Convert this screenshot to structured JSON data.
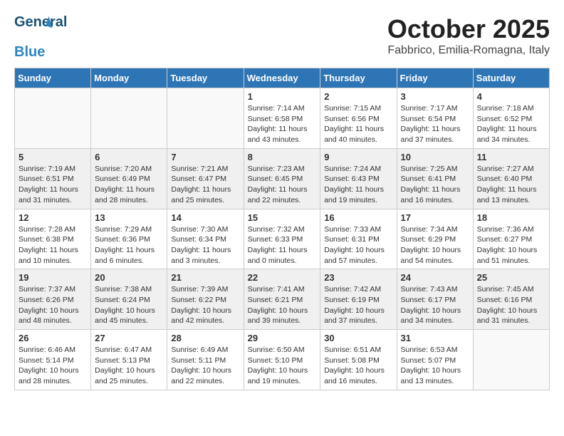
{
  "header": {
    "logo_line1": "General",
    "logo_line2": "Blue",
    "month": "October 2025",
    "location": "Fabbrico, Emilia-Romagna, Italy"
  },
  "weekdays": [
    "Sunday",
    "Monday",
    "Tuesday",
    "Wednesday",
    "Thursday",
    "Friday",
    "Saturday"
  ],
  "weeks": [
    [
      {
        "day": "",
        "info": ""
      },
      {
        "day": "",
        "info": ""
      },
      {
        "day": "",
        "info": ""
      },
      {
        "day": "1",
        "info": "Sunrise: 7:14 AM\nSunset: 6:58 PM\nDaylight: 11 hours\nand 43 minutes."
      },
      {
        "day": "2",
        "info": "Sunrise: 7:15 AM\nSunset: 6:56 PM\nDaylight: 11 hours\nand 40 minutes."
      },
      {
        "day": "3",
        "info": "Sunrise: 7:17 AM\nSunset: 6:54 PM\nDaylight: 11 hours\nand 37 minutes."
      },
      {
        "day": "4",
        "info": "Sunrise: 7:18 AM\nSunset: 6:52 PM\nDaylight: 11 hours\nand 34 minutes."
      }
    ],
    [
      {
        "day": "5",
        "info": "Sunrise: 7:19 AM\nSunset: 6:51 PM\nDaylight: 11 hours\nand 31 minutes."
      },
      {
        "day": "6",
        "info": "Sunrise: 7:20 AM\nSunset: 6:49 PM\nDaylight: 11 hours\nand 28 minutes."
      },
      {
        "day": "7",
        "info": "Sunrise: 7:21 AM\nSunset: 6:47 PM\nDaylight: 11 hours\nand 25 minutes."
      },
      {
        "day": "8",
        "info": "Sunrise: 7:23 AM\nSunset: 6:45 PM\nDaylight: 11 hours\nand 22 minutes."
      },
      {
        "day": "9",
        "info": "Sunrise: 7:24 AM\nSunset: 6:43 PM\nDaylight: 11 hours\nand 19 minutes."
      },
      {
        "day": "10",
        "info": "Sunrise: 7:25 AM\nSunset: 6:41 PM\nDaylight: 11 hours\nand 16 minutes."
      },
      {
        "day": "11",
        "info": "Sunrise: 7:27 AM\nSunset: 6:40 PM\nDaylight: 11 hours\nand 13 minutes."
      }
    ],
    [
      {
        "day": "12",
        "info": "Sunrise: 7:28 AM\nSunset: 6:38 PM\nDaylight: 11 hours\nand 10 minutes."
      },
      {
        "day": "13",
        "info": "Sunrise: 7:29 AM\nSunset: 6:36 PM\nDaylight: 11 hours\nand 6 minutes."
      },
      {
        "day": "14",
        "info": "Sunrise: 7:30 AM\nSunset: 6:34 PM\nDaylight: 11 hours\nand 3 minutes."
      },
      {
        "day": "15",
        "info": "Sunrise: 7:32 AM\nSunset: 6:33 PM\nDaylight: 11 hours\nand 0 minutes."
      },
      {
        "day": "16",
        "info": "Sunrise: 7:33 AM\nSunset: 6:31 PM\nDaylight: 10 hours\nand 57 minutes."
      },
      {
        "day": "17",
        "info": "Sunrise: 7:34 AM\nSunset: 6:29 PM\nDaylight: 10 hours\nand 54 minutes."
      },
      {
        "day": "18",
        "info": "Sunrise: 7:36 AM\nSunset: 6:27 PM\nDaylight: 10 hours\nand 51 minutes."
      }
    ],
    [
      {
        "day": "19",
        "info": "Sunrise: 7:37 AM\nSunset: 6:26 PM\nDaylight: 10 hours\nand 48 minutes."
      },
      {
        "day": "20",
        "info": "Sunrise: 7:38 AM\nSunset: 6:24 PM\nDaylight: 10 hours\nand 45 minutes."
      },
      {
        "day": "21",
        "info": "Sunrise: 7:39 AM\nSunset: 6:22 PM\nDaylight: 10 hours\nand 42 minutes."
      },
      {
        "day": "22",
        "info": "Sunrise: 7:41 AM\nSunset: 6:21 PM\nDaylight: 10 hours\nand 39 minutes."
      },
      {
        "day": "23",
        "info": "Sunrise: 7:42 AM\nSunset: 6:19 PM\nDaylight: 10 hours\nand 37 minutes."
      },
      {
        "day": "24",
        "info": "Sunrise: 7:43 AM\nSunset: 6:17 PM\nDaylight: 10 hours\nand 34 minutes."
      },
      {
        "day": "25",
        "info": "Sunrise: 7:45 AM\nSunset: 6:16 PM\nDaylight: 10 hours\nand 31 minutes."
      }
    ],
    [
      {
        "day": "26",
        "info": "Sunrise: 6:46 AM\nSunset: 5:14 PM\nDaylight: 10 hours\nand 28 minutes."
      },
      {
        "day": "27",
        "info": "Sunrise: 6:47 AM\nSunset: 5:13 PM\nDaylight: 10 hours\nand 25 minutes."
      },
      {
        "day": "28",
        "info": "Sunrise: 6:49 AM\nSunset: 5:11 PM\nDaylight: 10 hours\nand 22 minutes."
      },
      {
        "day": "29",
        "info": "Sunrise: 6:50 AM\nSunset: 5:10 PM\nDaylight: 10 hours\nand 19 minutes."
      },
      {
        "day": "30",
        "info": "Sunrise: 6:51 AM\nSunset: 5:08 PM\nDaylight: 10 hours\nand 16 minutes."
      },
      {
        "day": "31",
        "info": "Sunrise: 6:53 AM\nSunset: 5:07 PM\nDaylight: 10 hours\nand 13 minutes."
      },
      {
        "day": "",
        "info": ""
      }
    ]
  ]
}
